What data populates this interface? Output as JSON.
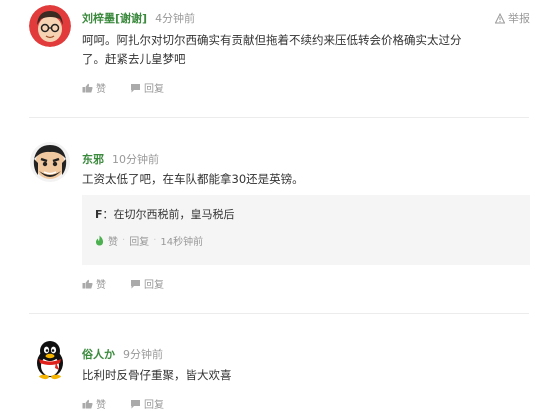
{
  "comments": [
    {
      "username": "刘梓墨[谢谢]",
      "time": "4分钟前",
      "text": "呵呵。阿扎尔对切尔西确实有贡献但拖着不续约来压低转会价格确实太过分了。赶紧去儿皇梦吧",
      "like_label": "赞",
      "reply_label": "回复",
      "report_label": "举报"
    },
    {
      "username": "东邪",
      "time": "10分钟前",
      "text": "工资太低了吧，在车队都能拿30还是英镑。",
      "like_label": "赞",
      "reply_label": "回复",
      "quote": {
        "author": "F",
        "separator": "：",
        "text": "在切尔西税前，皇马税后",
        "like_label": "赞",
        "reply_label": "回复",
        "time": "14秒钟前",
        "dot": "·"
      }
    },
    {
      "username": "俗人か",
      "time": "9分钟前",
      "text": "比利时反骨仔重聚，皆大欢喜",
      "like_label": "赞",
      "reply_label": "回复"
    }
  ],
  "colors": {
    "username": "#3b8a3e",
    "muted": "#999999",
    "divider": "#ececec",
    "quote_bg": "#f5f5f5"
  },
  "icons": [
    "flag-icon",
    "thumb-up-icon",
    "reply-icon",
    "flame-icon"
  ]
}
